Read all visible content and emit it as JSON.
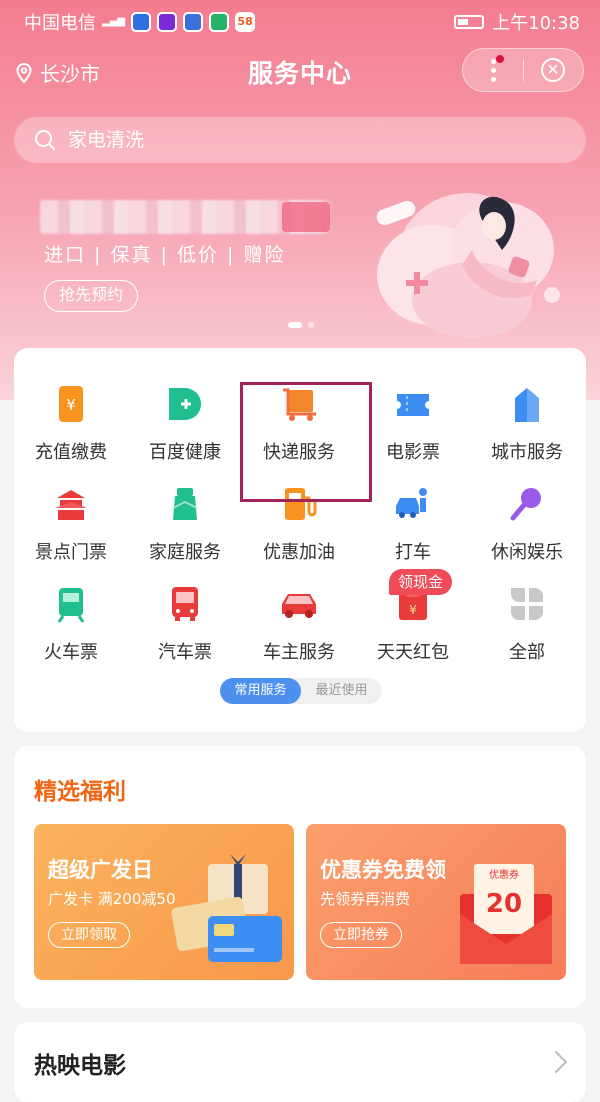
{
  "status": {
    "carrier": "中国电信",
    "time": "上午10:38",
    "app_icons": [
      "shield-app",
      "video-app",
      "baidu-app",
      "qq-app",
      "58-app"
    ],
    "app_58": "58"
  },
  "header": {
    "city": "长沙市",
    "title": "服务中心"
  },
  "search": {
    "placeholder": "家电清洗"
  },
  "banner": {
    "tagline": "进口 | 保真 | 低价 | 赠险",
    "button": "抢先预约"
  },
  "services": [
    {
      "label": "充值缴费",
      "icon": "recharge-icon",
      "color": "#f7931e"
    },
    {
      "label": "百度健康",
      "icon": "health-icon",
      "color": "#1fbf8f"
    },
    {
      "label": "快递服务",
      "icon": "express-icon",
      "color": "#f6862a"
    },
    {
      "label": "电影票",
      "icon": "ticket-icon",
      "color": "#3c8ef2"
    },
    {
      "label": "城市服务",
      "icon": "building-icon",
      "color": "#3c8ef2"
    },
    {
      "label": "景点门票",
      "icon": "temple-icon",
      "color": "#ea3b3b"
    },
    {
      "label": "家庭服务",
      "icon": "home-service-icon",
      "color": "#1fbf8f"
    },
    {
      "label": "优惠加油",
      "icon": "fuel-icon",
      "color": "#f7931e"
    },
    {
      "label": "打车",
      "icon": "taxi-icon",
      "color": "#3c8ef2"
    },
    {
      "label": "休闲娱乐",
      "icon": "mic-icon",
      "color": "#9b59e8"
    },
    {
      "label": "火车票",
      "icon": "train-icon",
      "color": "#1fbf8f"
    },
    {
      "label": "汽车票",
      "icon": "bus-icon",
      "color": "#ea3b3b"
    },
    {
      "label": "车主服务",
      "icon": "car-icon",
      "color": "#ea3b3b"
    },
    {
      "label": "天天红包",
      "icon": "red-packet-icon",
      "color": "#ea3b3b"
    },
    {
      "label": "全部",
      "icon": "all-icon",
      "color": "#c8c8c8"
    }
  ],
  "services_badge": "领现金",
  "services_tabs": {
    "active": "常用服务",
    "inactive": "最近使用"
  },
  "welfare": {
    "title": "精选福利",
    "cards": [
      {
        "title": "超级广发日",
        "subtitle": "广发卡 满200减50",
        "button": "立即领取"
      },
      {
        "title": "优惠券免费领",
        "subtitle": "先领券再消费",
        "button": "立即抢券",
        "coupon_label": "优惠券",
        "coupon_value": "20"
      }
    ]
  },
  "movies": {
    "title": "热映电影"
  }
}
